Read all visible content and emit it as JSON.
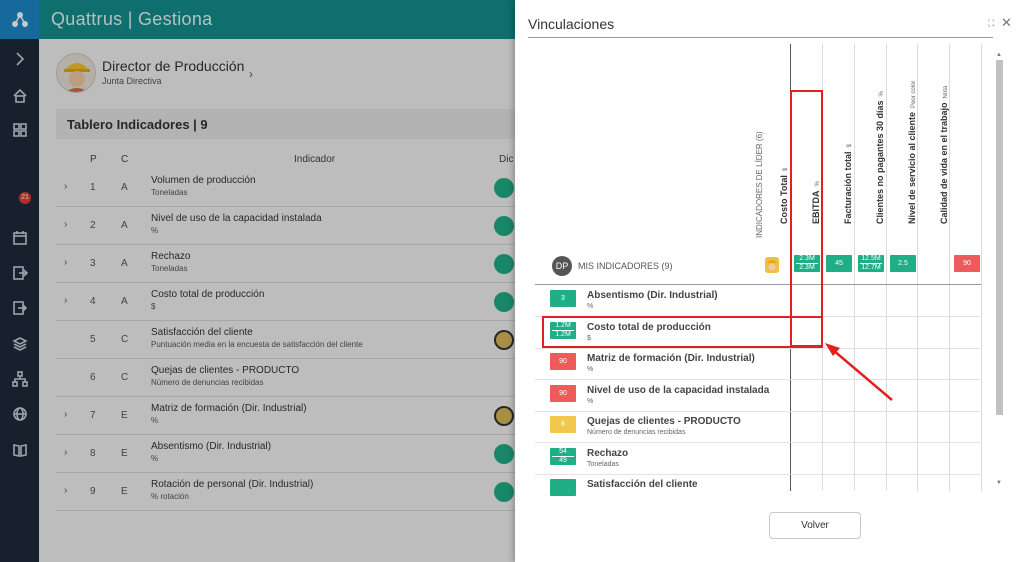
{
  "app": {
    "title": "Quattrus | Gestiona",
    "colors": {
      "topbar": "#138f8d",
      "nav": "#1e2a3a",
      "green": "#1fae86",
      "red": "#ef5b5b",
      "yellow": "#f1c84b",
      "highlight": "#e22020"
    }
  },
  "nav": {
    "badge": "21",
    "icons": [
      "expand-icon",
      "home-icon",
      "dashboard-icon",
      "notification-icon",
      "calendar-icon",
      "export-icon",
      "logout-icon",
      "layers-icon",
      "org-chart-icon",
      "globe-icon",
      "book-icon"
    ]
  },
  "profile": {
    "name": "Director de Producción",
    "role": "Junta Directiva"
  },
  "board": {
    "title": "Tablero Indicadores | 9",
    "headers": {
      "p": "P",
      "c": "C",
      "indicador": "Indicador",
      "dic": "Dic"
    },
    "rows": [
      {
        "p": "1",
        "c": "A",
        "name": "Volumen de producción",
        "unit": "Toneladas",
        "status": "green",
        "expandable": true
      },
      {
        "p": "2",
        "c": "A",
        "name": "Nivel de uso de la capacidad instalada",
        "unit": "%",
        "status": "green",
        "expandable": true
      },
      {
        "p": "3",
        "c": "A",
        "name": "Rechazo",
        "unit": "Toneladas",
        "status": "green",
        "expandable": true
      },
      {
        "p": "4",
        "c": "A",
        "name": "Costo total de producción",
        "unit": "$",
        "status": "green",
        "expandable": true
      },
      {
        "p": "5",
        "c": "C",
        "name": "Satisfacción del cliente",
        "unit": "Puntuación media en la encuesta de satisfacción del cliente",
        "status": "gold",
        "expandable": false
      },
      {
        "p": "6",
        "c": "C",
        "name": "Quejas de clientes - PRODUCTO",
        "unit": "Número de denuncias recibidas",
        "status": "none",
        "expandable": false
      },
      {
        "p": "7",
        "c": "E",
        "name": "Matriz de formación (Dir. Industrial)",
        "unit": "%",
        "status": "gold",
        "expandable": true
      },
      {
        "p": "8",
        "c": "E",
        "name": "Absentismo (Dir. Industrial)",
        "unit": "%",
        "status": "green",
        "expandable": true
      },
      {
        "p": "9",
        "c": "E",
        "name": "Rotación de personal (Dir. Industrial)",
        "unit": "% rotación",
        "status": "green",
        "expandable": true
      }
    ]
  },
  "modal": {
    "title": "Vinculaciones",
    "leader_col": "INDICADORES DE LÍDER (6)",
    "my_indicators_initials": "DP",
    "my_indicators": "MIS INDICADORES (9)",
    "columns": [
      {
        "name": "Costo Total",
        "unit": "$",
        "chip": {
          "color": "green",
          "top": "2.3M",
          "bottom": "2.3M"
        }
      },
      {
        "name": "EBITDA",
        "unit": "%",
        "chip": {
          "color": "green",
          "value": "45"
        }
      },
      {
        "name": "Facturación total",
        "unit": "$",
        "chip": {
          "color": "green",
          "top": "12.5M",
          "bottom": "12.7M"
        }
      },
      {
        "name": "Clientes no pagantes 30 días",
        "unit": "%",
        "chip": {
          "color": "green",
          "value": "2.5"
        }
      },
      {
        "name": "Nivel de servicio al cliente",
        "unit": "Peor color",
        "chip": null
      },
      {
        "name": "Calidad de vida en el trabajo",
        "unit": "Nota",
        "chip": {
          "color": "red",
          "value": "90"
        }
      }
    ],
    "indicators": [
      {
        "name": "Absentismo (Dir. Industrial)",
        "unit": "%",
        "chip": {
          "color": "green",
          "value": "3"
        }
      },
      {
        "name": "Costo total de producción",
        "unit": "$",
        "chip": {
          "color": "green",
          "top": "1.2M",
          "bottom": "1.2M"
        }
      },
      {
        "name": "Matriz de formación (Dir. Industrial)",
        "unit": "%",
        "chip": {
          "color": "red",
          "value": "90"
        }
      },
      {
        "name": "Nivel de uso de la capacidad instalada",
        "unit": "%",
        "chip": {
          "color": "red",
          "value": "90"
        }
      },
      {
        "name": "Quejas de clientes - PRODUCTO",
        "unit": "Número de denuncias recibidas",
        "chip": {
          "color": "yellow",
          "value": "8"
        }
      },
      {
        "name": "Rechazo",
        "unit": "Toneladas",
        "chip": {
          "color": "green",
          "top": "54",
          "bottom": "49"
        }
      },
      {
        "name": "Satisfacción del cliente",
        "unit": "",
        "chip": {
          "color": "green",
          "value": ""
        }
      }
    ],
    "button": "Volver"
  }
}
